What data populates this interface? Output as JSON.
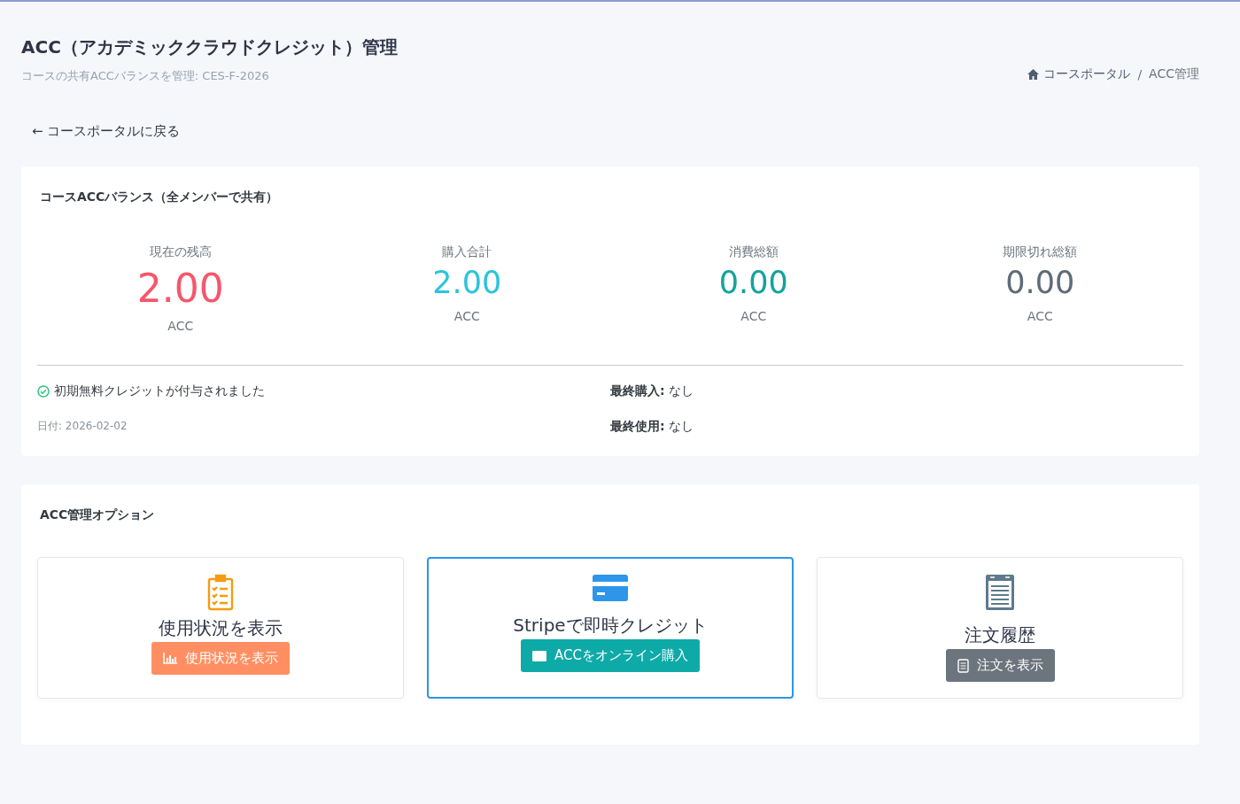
{
  "header": {
    "title": "ACC（アカデミッククラウドクレジット）管理",
    "subtitle": "コースの共有ACCバランスを管理: CES-F-2026"
  },
  "breadcrumb_separator": "/",
  "breadcrumb": [
    {
      "label": "コースポータル",
      "kind": "home"
    },
    {
      "label": "ACC管理",
      "kind": "current"
    }
  ],
  "back_link": "← コースポータルに戻る",
  "balance_card": {
    "title": "コースACCバランス（全メンバーで共有）",
    "stats": [
      {
        "label": "現在の残高",
        "value": "2.00",
        "unit": "ACC",
        "color": "#f5576c",
        "highlighted": true
      },
      {
        "label": "購入合計",
        "value": "2.00",
        "unit": "ACC",
        "color": "#2bc4dc",
        "highlighted": false
      },
      {
        "label": "消費総額",
        "value": "0.00",
        "unit": "ACC",
        "color": "#13a39c",
        "highlighted": false
      },
      {
        "label": "期限切れ総額",
        "value": "0.00",
        "unit": "ACC",
        "color": "#5f6b78",
        "highlighted": false
      }
    ],
    "notice": "初期無料クレジットが付与されました",
    "date": "日付: 2026-02-02",
    "details": [
      {
        "label": "最終購入:",
        "value": "なし"
      },
      {
        "label": "最終使用:",
        "value": "なし"
      }
    ]
  },
  "options_card": {
    "title": "ACC管理オプション",
    "options": [
      {
        "kind": "usage",
        "title": "使用状況を表示",
        "button": "使用状況を表示",
        "color": "#ff8f62",
        "selected": false
      },
      {
        "kind": "purchase",
        "title": "Stripeで即時クレジット",
        "button": "ACCをオンライン購入",
        "color": "#0eaaa8",
        "selected": true
      },
      {
        "kind": "orders",
        "title": "注文履歴",
        "button": "注文を表示",
        "color": "#6c757d",
        "selected": false
      }
    ]
  }
}
